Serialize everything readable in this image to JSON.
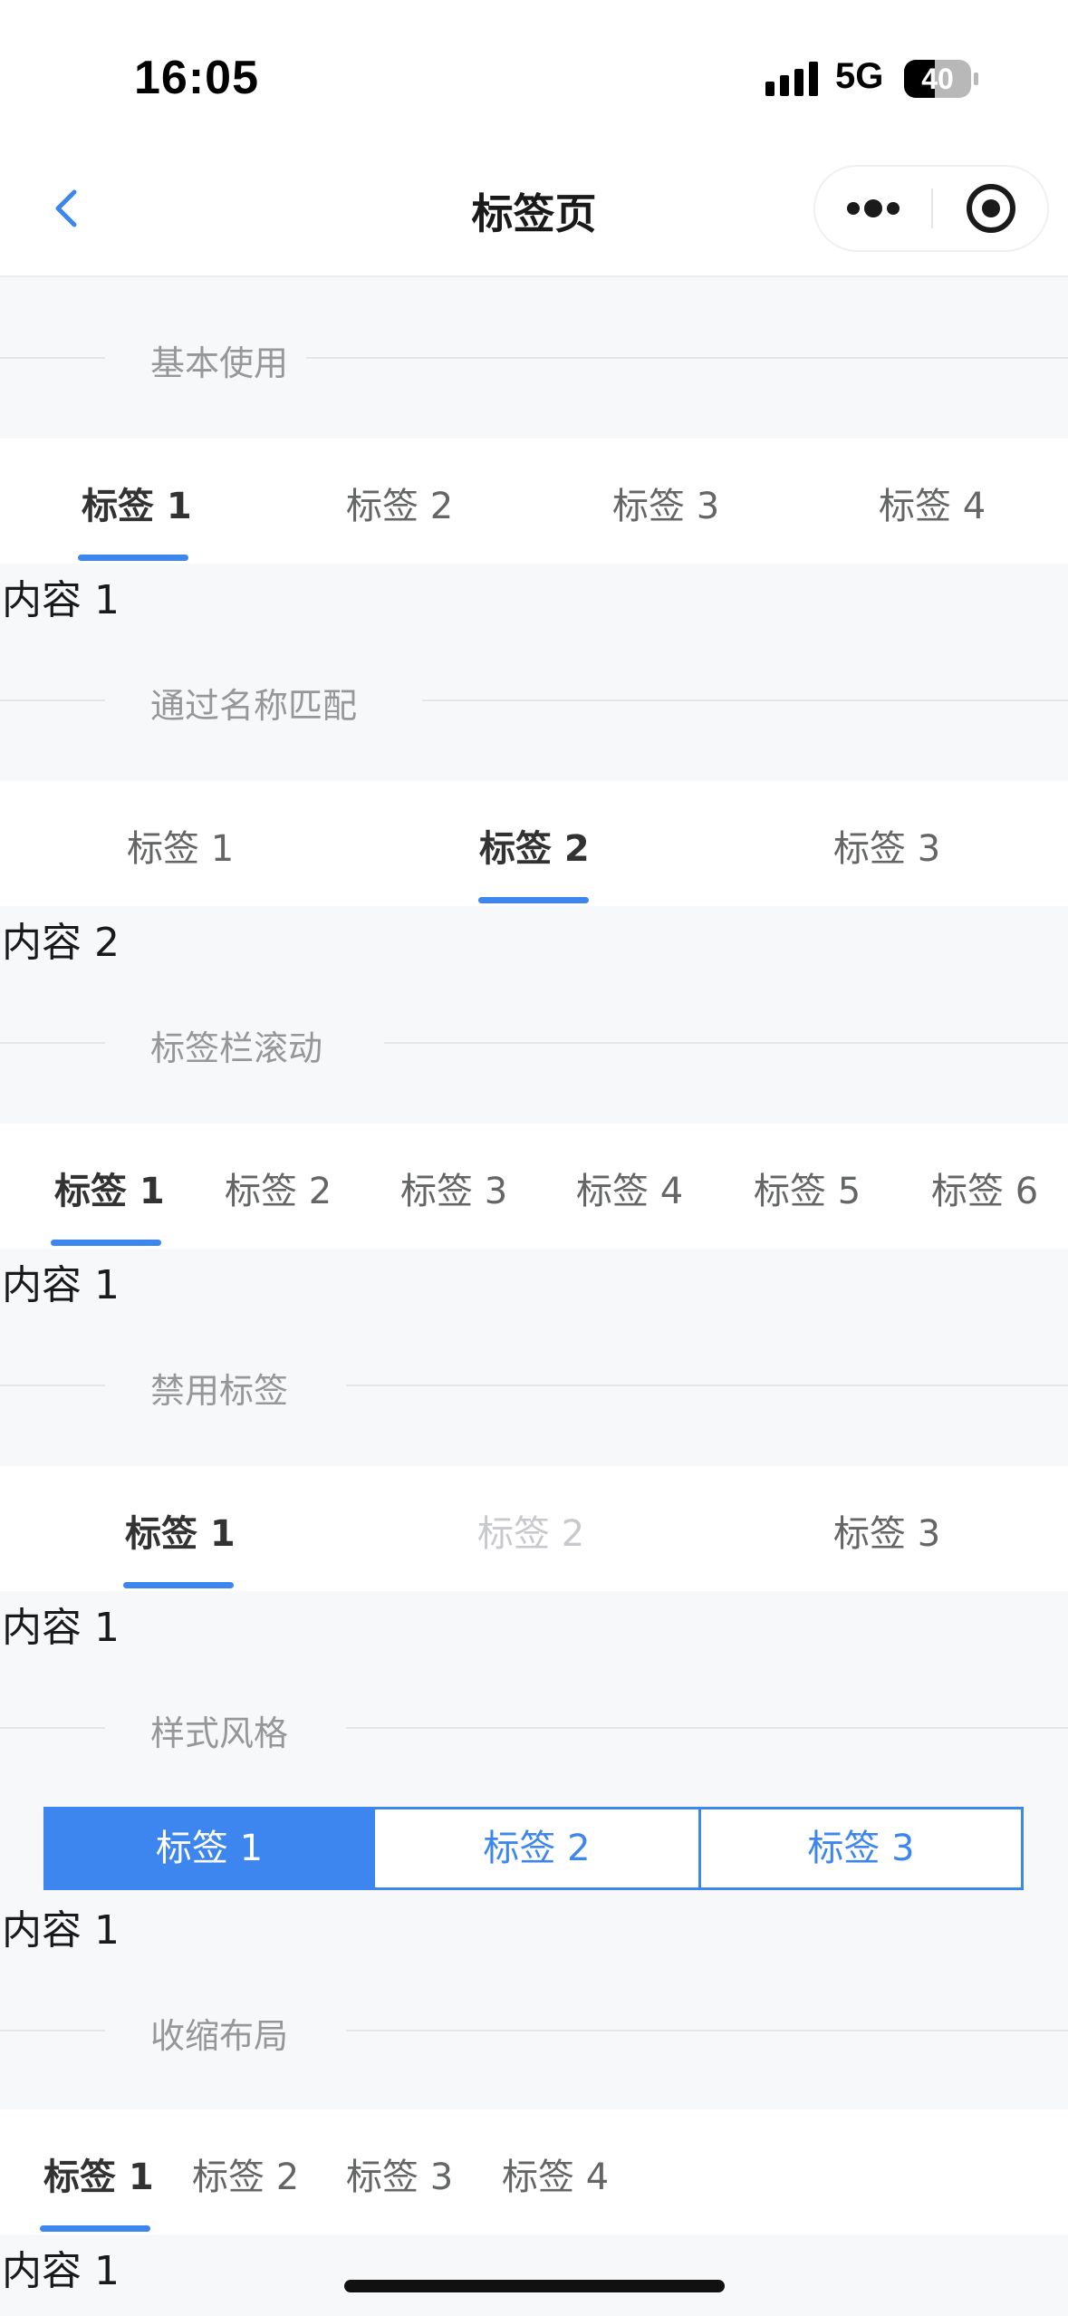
{
  "status_bar": {
    "time": "16:05",
    "network": "5G",
    "battery": "40"
  },
  "nav": {
    "title": "标签页"
  },
  "sections": {
    "basic": {
      "header": "基本使用",
      "tabs": [
        "标签 1",
        "标签 2",
        "标签 3",
        "标签 4"
      ],
      "active_index": 0,
      "content": "内容 1"
    },
    "name_match": {
      "header": "通过名称匹配",
      "tabs": [
        "标签 1",
        "标签 2",
        "标签 3"
      ],
      "active_index": 1,
      "content": "内容 2"
    },
    "scroll": {
      "header": "标签栏滚动",
      "tabs": [
        "标签 1",
        "标签 2",
        "标签 3",
        "标签 4",
        "标签 5",
        "标签 6"
      ],
      "active_index": 0,
      "content": "内容 1"
    },
    "disabled": {
      "header": "禁用标签",
      "tabs": [
        "标签 1",
        "标签 2",
        "标签 3"
      ],
      "active_index": 0,
      "disabled_index": 1,
      "content": "内容 1"
    },
    "style": {
      "header": "样式风格",
      "tabs": [
        "标签 1",
        "标签 2",
        "标签 3"
      ],
      "active_index": 0,
      "content": "内容 1"
    },
    "shrink": {
      "header": "收缩布局",
      "tabs": [
        "标签 1",
        "标签 2",
        "标签 3",
        "标签 4"
      ],
      "active_index": 0,
      "content": "内容 1"
    }
  },
  "colors": {
    "accent": "#3d86ef",
    "page_bg": "#f7f8fa",
    "tab_bg": "#ffffff",
    "text_active": "#323233",
    "text_inactive": "#646566",
    "text_disabled": "#c8c9cc",
    "header_text": "#969799"
  },
  "icons": [
    "back-chevron-icon",
    "more-dots-icon",
    "record-target-icon",
    "cellular-signal-icon",
    "battery-icon"
  ]
}
